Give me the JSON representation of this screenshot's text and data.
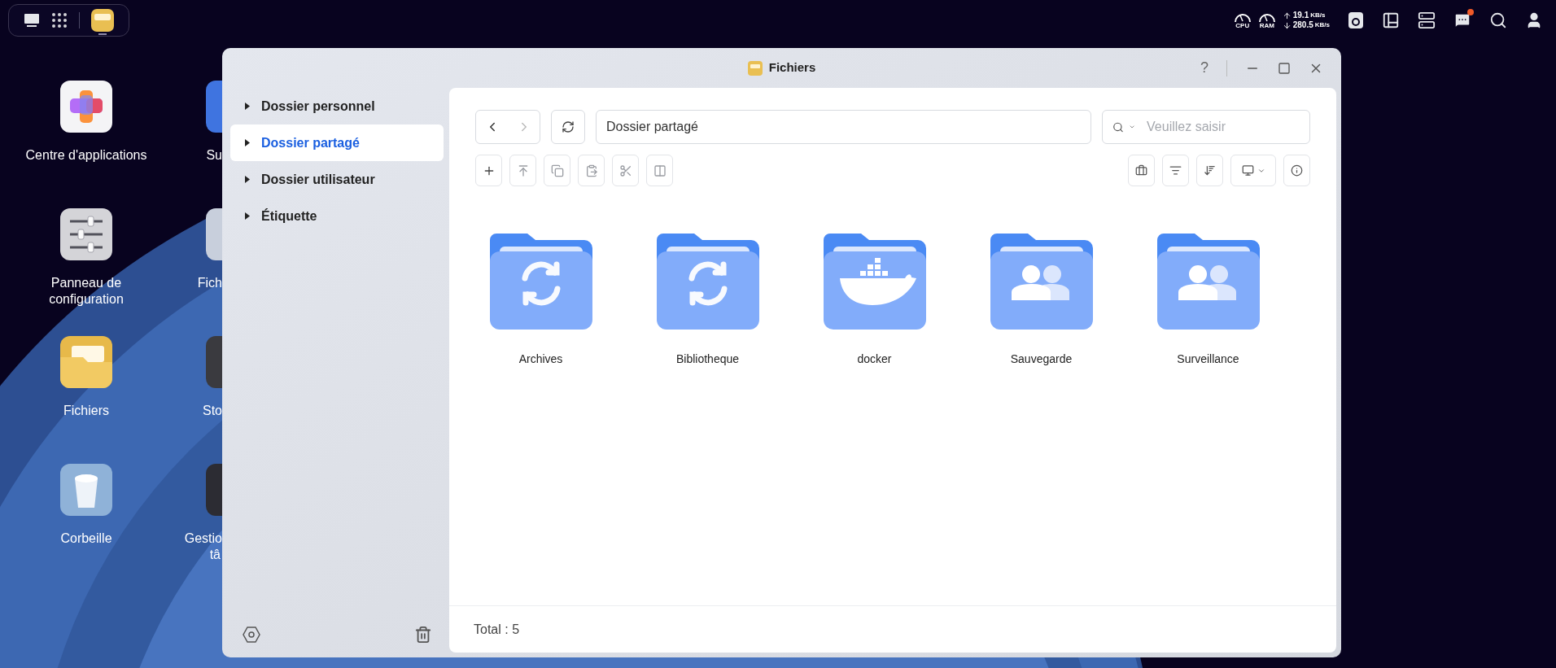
{
  "taskbar": {
    "apps": [
      {
        "running": true
      }
    ]
  },
  "status": {
    "cpu_label": "CPU",
    "ram_label": "RAM",
    "upload_value": "19.1",
    "upload_unit": "KB/s",
    "download_value": "280.5",
    "download_unit": "KB/s",
    "messages_unread": true
  },
  "desktop": {
    "column_1": [
      {
        "label": "Centre d'applications",
        "kind": "apps"
      },
      {
        "label": "Panneau de configuration",
        "kind": "settings"
      },
      {
        "label": "Fichiers",
        "kind": "files"
      },
      {
        "label": "Corbeille",
        "kind": "trash"
      }
    ],
    "column_2": [
      {
        "lines": [
          "Su"
        ],
        "kind": "blue"
      },
      {
        "lines": [
          "Fich"
        ],
        "kind": "doc"
      },
      {
        "lines": [
          "Sto"
        ],
        "kind": "dark"
      },
      {
        "lines": [
          "Gestio",
          "tâ"
        ],
        "kind": "monitor"
      }
    ]
  },
  "window": {
    "title": "Fichiers",
    "help_label": "?",
    "sidebar": {
      "items": [
        {
          "label": "Dossier personnel",
          "selected": false
        },
        {
          "label": "Dossier partagé",
          "selected": true
        },
        {
          "label": "Dossier utilisateur",
          "selected": false
        },
        {
          "label": "Étiquette",
          "selected": false
        }
      ]
    },
    "toolbar": {
      "back_disabled": false,
      "forward_disabled": true,
      "path": "Dossier partagé",
      "search_placeholder": "Veuillez saisir",
      "actions": [
        {
          "disabled": false
        },
        {
          "disabled": true
        },
        {
          "disabled": true
        },
        {
          "disabled": true
        },
        {
          "disabled": true
        },
        {
          "disabled": true
        }
      ]
    },
    "folders": [
      {
        "name": "Archives",
        "kind": "sync"
      },
      {
        "name": "Bibliotheque",
        "kind": "sync"
      },
      {
        "name": "docker",
        "kind": "docker"
      },
      {
        "name": "Sauvegarde",
        "kind": "users"
      },
      {
        "name": "Surveillance",
        "kind": "users"
      }
    ],
    "status_bar": "Total : 5"
  }
}
